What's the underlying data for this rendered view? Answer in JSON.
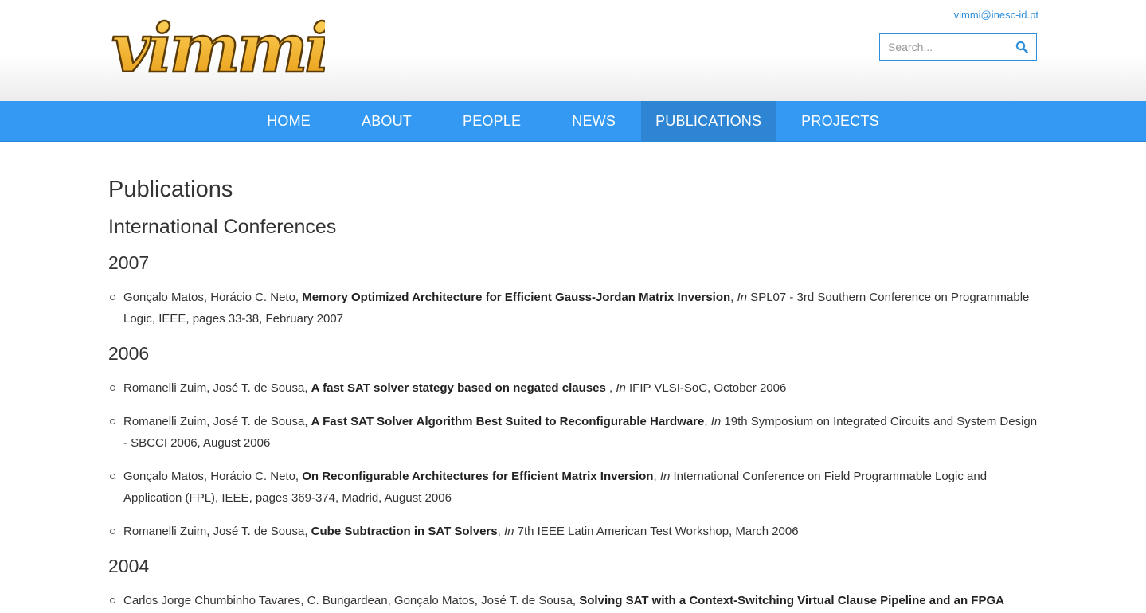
{
  "header": {
    "logo_text": "vimmi",
    "email": "vimmi@inesc-id.pt",
    "search_placeholder": "Search..."
  },
  "nav": {
    "items": [
      {
        "label": "HOME"
      },
      {
        "label": "ABOUT"
      },
      {
        "label": "PEOPLE"
      },
      {
        "label": "NEWS"
      },
      {
        "label": "PUBLICATIONS",
        "active": true
      },
      {
        "label": "PROJECTS"
      }
    ]
  },
  "page": {
    "title": "Publications",
    "section": "International Conferences"
  },
  "years": [
    {
      "year": "2007",
      "pubs": [
        {
          "authors": "Gonçalo Matos, Horácio C. Neto, ",
          "title": "Memory Optimized Architecture for Efficient Gauss-Jordan Matrix Inversion",
          "sep": ", ",
          "in": "In",
          "venue": " SPL07 - 3rd Southern Conference on Programmable Logic, IEEE, pages 33-38, February 2007"
        }
      ]
    },
    {
      "year": "2006",
      "pubs": [
        {
          "authors": "Romanelli Zuim, José T. de Sousa, ",
          "title": "A fast SAT solver stategy based on negated clauses ",
          "sep": ", ",
          "in": "In",
          "venue": " IFIP VLSI-SoC, October 2006"
        },
        {
          "authors": "Romanelli Zuim, José T. de Sousa, ",
          "title": "A Fast SAT Solver Algorithm Best Suited to Reconfigurable Hardware",
          "sep": ", ",
          "in": "In",
          "venue": " 19th Symposium on Integrated Circuits and System Design - SBCCI 2006, August 2006"
        },
        {
          "authors": "Gonçalo Matos, Horácio C. Neto, ",
          "title": "On Reconfigurable Architectures for Efficient Matrix Inversion",
          "sep": ", ",
          "in": "In",
          "venue": " International Conference on Field Programmable Logic and Application (FPL), IEEE, pages 369-374, Madrid, August 2006"
        },
        {
          "authors": "Romanelli Zuim, José T. de Sousa, ",
          "title": "Cube Subtraction in SAT Solvers",
          "sep": ", ",
          "in": "In",
          "venue": " 7th IEEE Latin American Test Workshop, March 2006"
        }
      ]
    },
    {
      "year": "2004",
      "pubs": [
        {
          "authors": "Carlos Jorge Chumbinho Tavares, C. Bungardean, Gonçalo Matos, José T. de Sousa, ",
          "title": "Solving SAT with a Context-Switching Virtual Clause Pipeline and an FPGA",
          "sep": "",
          "in": "",
          "venue": ""
        }
      ]
    }
  ],
  "colors": {
    "nav_bg": "#3399f3",
    "nav_active": "#2d85d4",
    "link": "#2f8fdb",
    "logo": "#f5b325"
  }
}
